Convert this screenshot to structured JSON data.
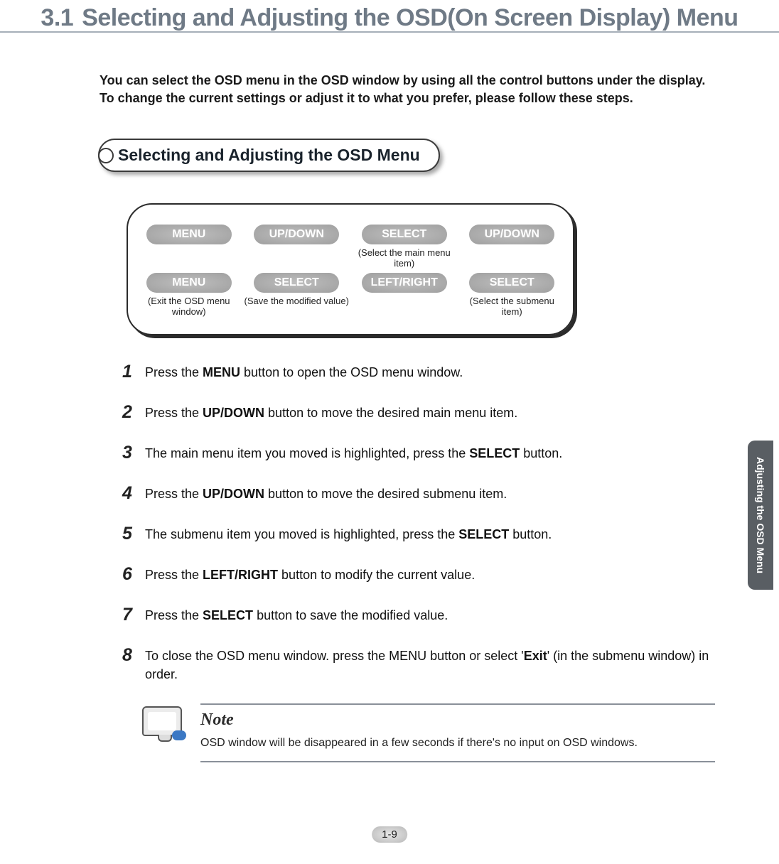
{
  "section_number": "3.1",
  "section_title": "Selecting and Adjusting the OSD(On Screen Display) Menu",
  "intro": "You can select the OSD menu in the OSD window by using all the control buttons under the display. To change the current settings or adjust it to what you prefer, please follow these steps.",
  "subheading": "Selecting and Adjusting the OSD Menu",
  "buttons": {
    "row1": [
      {
        "label": "MENU",
        "caption": ""
      },
      {
        "label": "UP/DOWN",
        "caption": ""
      },
      {
        "label": "SELECT",
        "caption": "(Select the main menu item)"
      },
      {
        "label": "UP/DOWN",
        "caption": ""
      }
    ],
    "row2": [
      {
        "label": "MENU",
        "caption": "(Exit the OSD menu window)"
      },
      {
        "label": "SELECT",
        "caption": "(Save the modified value)"
      },
      {
        "label": "LEFT/RIGHT",
        "caption": ""
      },
      {
        "label": "SELECT",
        "caption": "(Select the submenu item)"
      }
    ]
  },
  "steps": [
    {
      "n": "1",
      "prefix": "Press the ",
      "bold": "MENU",
      "suffix": " button to open the OSD menu window."
    },
    {
      "n": "2",
      "prefix": "Press the ",
      "bold": "UP/DOWN",
      "suffix": " button to move the desired main menu item."
    },
    {
      "n": "3",
      "prefix": "The main menu item you moved is highlighted, press the ",
      "bold": "SELECT",
      "suffix": " button."
    },
    {
      "n": "4",
      "prefix": "Press the ",
      "bold": "UP/DOWN",
      "suffix": " button to move the desired submenu item."
    },
    {
      "n": "5",
      "prefix": "The submenu item you moved is highlighted, press the ",
      "bold": "SELECT",
      "suffix": " button."
    },
    {
      "n": "6",
      "prefix": "Press the ",
      "bold": "LEFT/RIGHT",
      "suffix": " button to modify the current value."
    },
    {
      "n": "7",
      "prefix": "Press the ",
      "bold": "SELECT",
      "suffix": " button to save the modified value."
    },
    {
      "n": "8",
      "prefix": "To close the OSD menu window. press the MENU button or select  '",
      "bold": "Exit",
      "suffix": "' (in the submenu window) in order."
    }
  ],
  "note": {
    "label": "Note",
    "text": "OSD window will be disappeared in a few seconds if there's no input on OSD windows."
  },
  "page_number": "1-9",
  "side_tab": "Adjusting the OSD Menu"
}
